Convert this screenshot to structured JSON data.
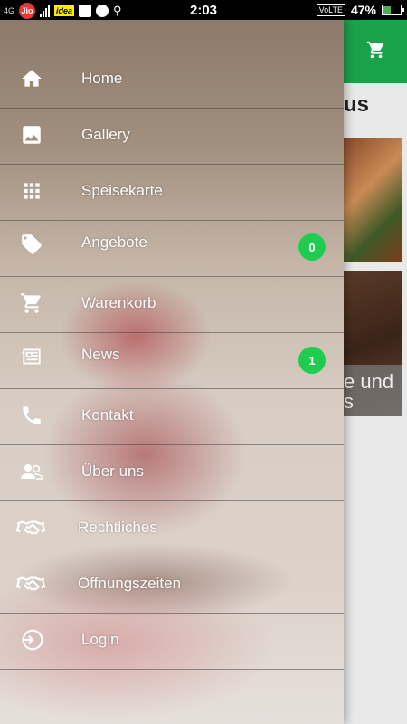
{
  "status_bar": {
    "network_label": "4G",
    "carrier1": "Jio",
    "carrier2": "idea",
    "time": "2:03",
    "volte": "VoLTE",
    "battery_percent": "47%",
    "battery_level": 0.47
  },
  "app": {
    "title_fragment": "us",
    "card_caption_line1": "e und",
    "card_caption_line2": "s"
  },
  "drawer": {
    "items": [
      {
        "label": "Home",
        "icon": "home-icon"
      },
      {
        "label": "Gallery",
        "icon": "image-icon"
      },
      {
        "label": "Speisekarte",
        "icon": "grid-icon"
      },
      {
        "label": "Angebote",
        "icon": "tag-icon",
        "badge": "0"
      },
      {
        "label": "Warenkorb",
        "icon": "cart-icon"
      },
      {
        "label": "News",
        "icon": "newspaper-icon",
        "badge": "1"
      },
      {
        "label": "Kontakt",
        "icon": "phone-icon"
      },
      {
        "label": "Über uns",
        "icon": "people-icon"
      },
      {
        "label": "Rechtliches",
        "icon": "handshake-icon"
      },
      {
        "label": "Öffnungszeiten",
        "icon": "handshake-icon"
      },
      {
        "label": "Login",
        "icon": "login-icon"
      }
    ]
  },
  "colors": {
    "appbar": "#1aa24a",
    "badge": "#1fcc50",
    "drawer_text": "#ffffff"
  }
}
